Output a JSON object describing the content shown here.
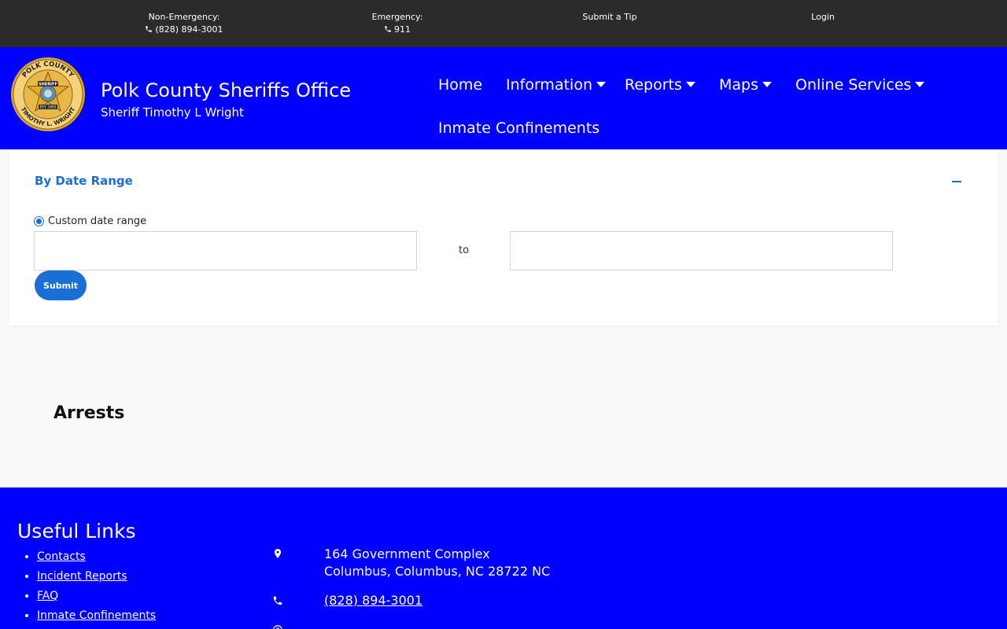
{
  "topbar": {
    "non_emergency_label": "Non-Emergency:",
    "non_emergency_phone": "(828) 894-3001",
    "emergency_label": "Emergency:",
    "emergency_phone": "911",
    "tip_label": "Submit a Tip",
    "login_label": "Login"
  },
  "header": {
    "title": "Polk County Sheriffs Office",
    "subtitle": "Sheriff Timothy L Wright",
    "logo_text_top": "POLK COUNTY",
    "logo_text_bottom": "TIMOTHY L. WRIGHT",
    "logo_badge": "SHERIFF",
    "logo_est": "EST. 1855"
  },
  "nav": {
    "home": "Home",
    "information": "Information",
    "reports": "Reports",
    "maps": "Maps",
    "online_services": "Online Services",
    "inmate": "Inmate Confinements"
  },
  "search": {
    "section_title": "By Date Range",
    "radio_label": "Custom date range",
    "start_value": "",
    "end_value": "",
    "to_label": "to",
    "submit_label": "Submit"
  },
  "main": {
    "arrests_title": "Arrests"
  },
  "footer": {
    "title": "Useful Links",
    "links": [
      "Contacts",
      "Incident Reports",
      "FAQ",
      "Inmate Confinements"
    ],
    "address_line1": "164 Government Complex",
    "address_line2": "Columbus, Columbus, NC 28722 NC",
    "phone": "(828) 894-3001"
  },
  "colors": {
    "brand_blue": "#0000ff",
    "accent_blue": "#1a6fd6",
    "topbar_bg": "#2b2b2b"
  }
}
